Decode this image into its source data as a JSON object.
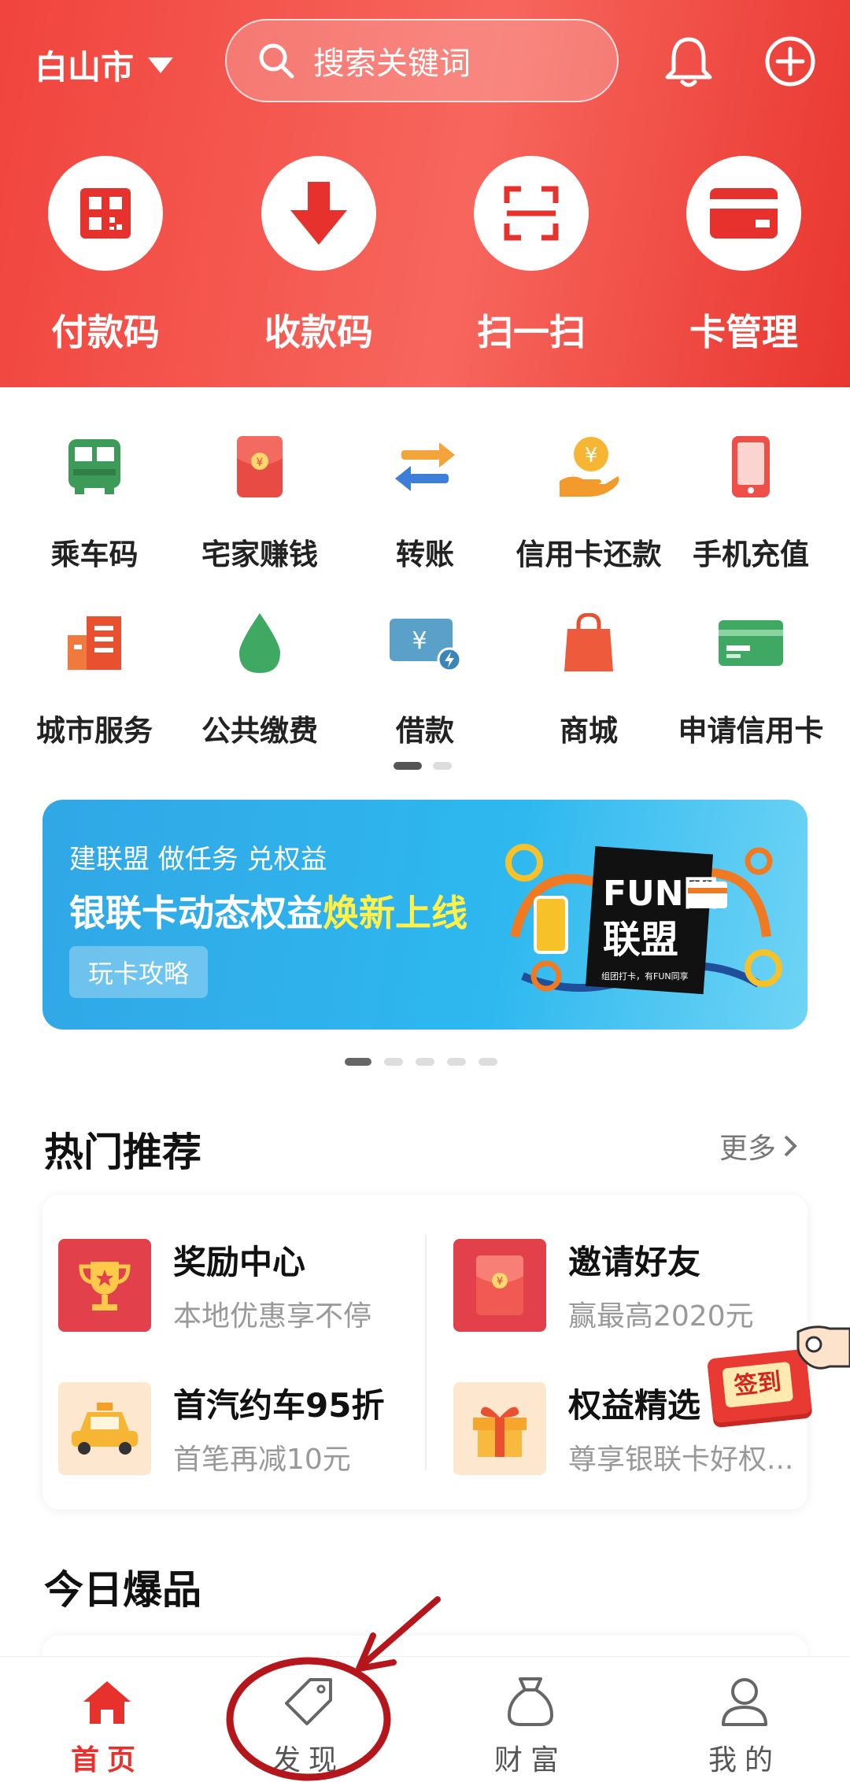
{
  "header": {
    "city": "白山市",
    "search_placeholder": "搜索关键词",
    "quick_actions": [
      {
        "label": "付款码",
        "icon": "qr-pay-icon"
      },
      {
        "label": "收款码",
        "icon": "receive-arrow-icon"
      },
      {
        "label": "扫一扫",
        "icon": "scan-icon"
      },
      {
        "label": "卡管理",
        "icon": "card-icon"
      }
    ]
  },
  "services": [
    {
      "label": "乘车码",
      "icon": "bus-icon"
    },
    {
      "label": "宅家赚钱",
      "icon": "red-envelope-icon"
    },
    {
      "label": "转账",
      "icon": "transfer-icon"
    },
    {
      "label": "信用卡还款",
      "icon": "repay-icon"
    },
    {
      "label": "手机充值",
      "icon": "phone-icon"
    },
    {
      "label": "城市服务",
      "icon": "building-icon"
    },
    {
      "label": "公共缴费",
      "icon": "water-drop-icon"
    },
    {
      "label": "借款",
      "icon": "loan-icon"
    },
    {
      "label": "商城",
      "icon": "shopping-bag-icon"
    },
    {
      "label": "申请信用卡",
      "icon": "credit-card-icon"
    }
  ],
  "banner": {
    "subtitle": "建联盟 做任务 兑权益",
    "title_main": "银联卡动态权益",
    "title_highlight": "焕新上线",
    "button": "玩卡攻略",
    "art_title_1": "FUN圈",
    "art_title_2": "联盟",
    "art_caption": "组团打卡，有FUN同享"
  },
  "hot": {
    "title": "热门推荐",
    "more": "更多",
    "items": [
      {
        "title": "奖励中心",
        "desc": "本地优惠享不停",
        "icon": "trophy-icon"
      },
      {
        "title": "邀请好友",
        "desc": "赢最高2020元",
        "icon": "red-envelope-icon"
      },
      {
        "title": "首汽约车95折",
        "desc": "首笔再减10元",
        "icon": "taxi-icon"
      },
      {
        "title": "权益精选",
        "desc": "尊享银联卡好权...",
        "icon": "gift-icon"
      }
    ],
    "sign_in": "签到"
  },
  "today": {
    "title": "今日爆品"
  },
  "tabs": [
    {
      "label": "首页",
      "icon": "home-icon",
      "active": true
    },
    {
      "label": "发现",
      "icon": "tag-icon",
      "active": false
    },
    {
      "label": "财富",
      "icon": "money-bag-icon",
      "active": false
    },
    {
      "label": "我的",
      "icon": "person-icon",
      "active": false
    }
  ],
  "colors": {
    "brand_red": "#e6312d",
    "banner_blue": "#31a7e6",
    "highlight_yellow": "#fff04a"
  }
}
